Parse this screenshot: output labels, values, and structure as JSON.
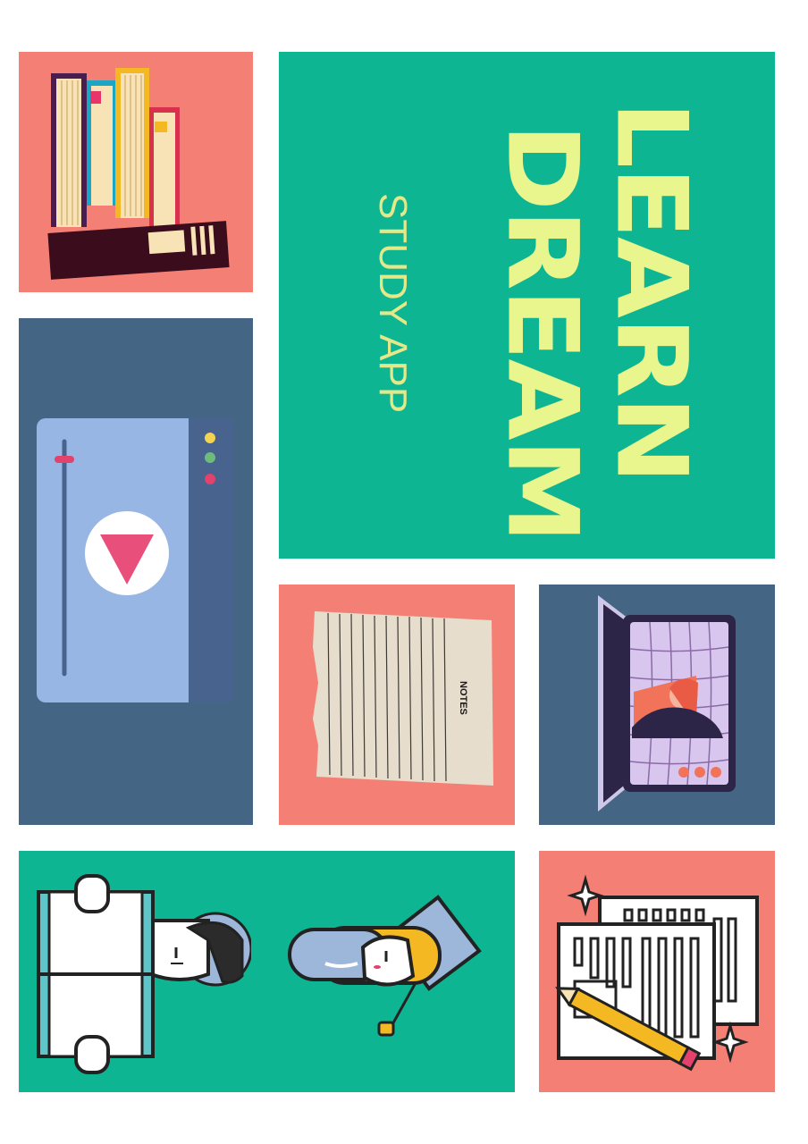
{
  "poster": {
    "title_line1": "LEARN",
    "title_line2": "DREAM",
    "subtitle": "STUDY APP",
    "notes_label": "NOTES"
  },
  "colors": {
    "salmon": "#f47f75",
    "teal": "#0db593",
    "slate": "#456584",
    "title_yellow": "#e9f58d"
  },
  "icons": [
    "books-icon",
    "video-player-icon",
    "play-icon",
    "notes-paper-icon",
    "video-call-laptop-icon",
    "student-reading-icon",
    "graduate-icon",
    "documents-pencil-icon",
    "sparkle-icon"
  ]
}
